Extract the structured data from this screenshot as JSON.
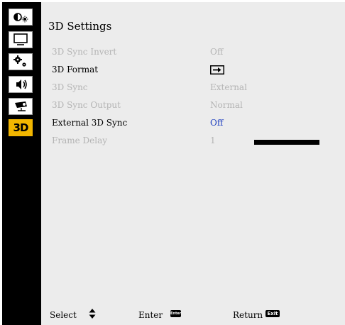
{
  "sidebar": {
    "items": [
      {
        "icon": "picture-brightness-icon"
      },
      {
        "icon": "screen-icon"
      },
      {
        "icon": "settings-gears-icon"
      },
      {
        "icon": "volume-icon"
      },
      {
        "icon": "projector-options-icon"
      },
      {
        "label": "3D",
        "icon": "3d-icon",
        "active": true
      }
    ]
  },
  "panel": {
    "title": "3D Settings",
    "rows": [
      {
        "name": "3D Sync Invert",
        "value": "Off",
        "state": "disabled"
      },
      {
        "name": "3D Format",
        "value_icon": "arrow-right-icon",
        "state": "enabled"
      },
      {
        "name": "3D Sync",
        "value": "External",
        "state": "disabled"
      },
      {
        "name": "3D Sync Output",
        "value": "Normal",
        "state": "disabled"
      },
      {
        "name": "External 3D Sync",
        "value": "Off",
        "state": "selected"
      },
      {
        "name": "Frame Delay",
        "value": "1",
        "state": "disabled",
        "slider_fill": 1.0
      }
    ]
  },
  "footer": {
    "select_label": "Select",
    "enter_label": "Enter",
    "enter_key": "Enter",
    "return_label": "Return",
    "exit_key": "Exit"
  },
  "colors": {
    "panel_bg": "#ececec",
    "active_tab": "#f2b600",
    "selected_value": "#1e3fbf",
    "disabled_text": "#b4b4b4"
  }
}
